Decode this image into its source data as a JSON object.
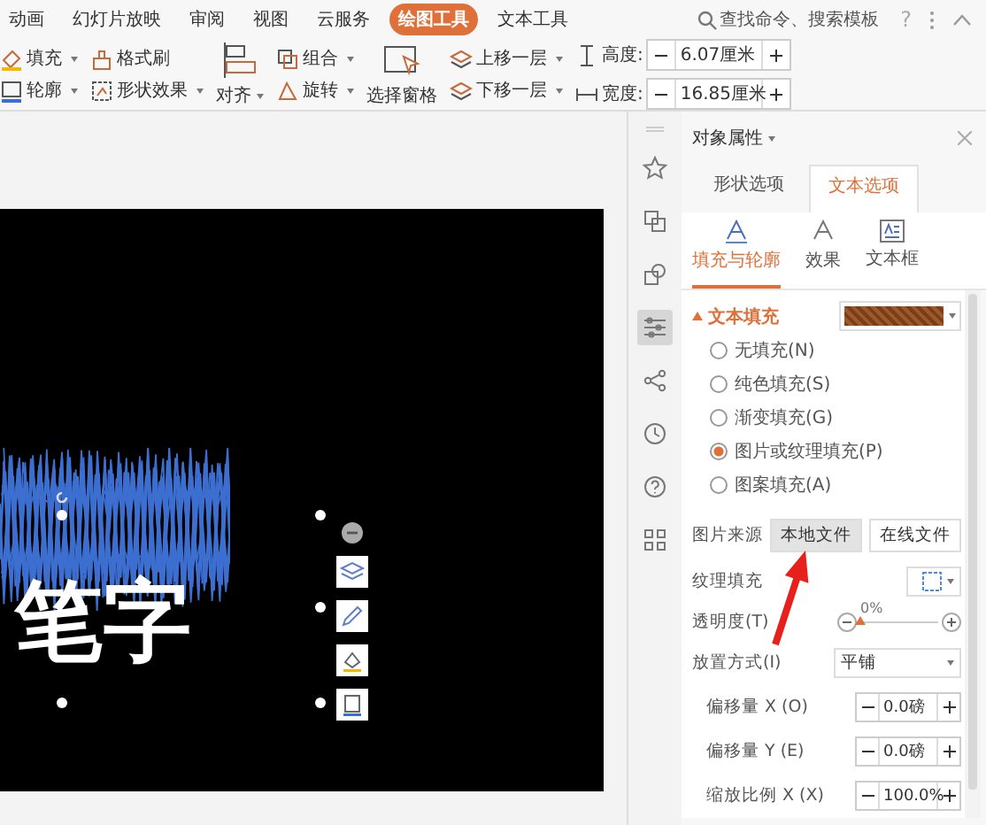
{
  "menu_tabs": [
    {
      "label": "动画",
      "selected": false
    },
    {
      "label": "幻灯片放映",
      "selected": false
    },
    {
      "label": "审阅",
      "selected": false
    },
    {
      "label": "视图",
      "selected": false
    },
    {
      "label": "云服务",
      "selected": false
    },
    {
      "label": "绘图工具",
      "selected": true
    },
    {
      "label": "文本工具",
      "selected": false
    }
  ],
  "search": {
    "placeholder": "查找命令、搜索模板"
  },
  "help": "?",
  "ribbon": [
    {
      "kind": "pair",
      "items": [
        {
          "label": "填充",
          "dropdown": true
        },
        {
          "label": "轮廓",
          "dropdown": true
        }
      ]
    },
    {
      "kind": "pair",
      "items": [
        {
          "label": "格式刷",
          "dropdown": false
        },
        {
          "label": "形状效果",
          "dropdown": true
        }
      ]
    },
    {
      "kind": "large",
      "label": "对齐",
      "dropdown": true
    },
    {
      "kind": "pair",
      "items": [
        {
          "label": "组合",
          "dropdown": true
        },
        {
          "label": "旋转",
          "dropdown": true
        }
      ]
    },
    {
      "kind": "large",
      "label": "选择窗格",
      "dropdown": false
    },
    {
      "kind": "pair",
      "items": [
        {
          "label": "上移一层",
          "dropdown": true
        },
        {
          "label": "下移一层",
          "dropdown": true
        }
      ]
    },
    {
      "kind": "size",
      "items": [
        {
          "label": "高度:",
          "value": "6.07厘米"
        },
        {
          "label": "宽度:",
          "value": "16.85厘米"
        }
      ]
    }
  ],
  "slide": {
    "text": "笔字"
  },
  "side_toolbar": [
    {
      "selected": false
    },
    {
      "selected": false
    },
    {
      "selected": false
    },
    {
      "selected": true
    },
    {
      "selected": false
    },
    {
      "selected": false
    },
    {
      "selected": false
    },
    {
      "selected": false
    }
  ],
  "panel": {
    "title": "对象属性",
    "tabs": [
      {
        "label": "形状选项",
        "selected": false
      },
      {
        "label": "文本选项",
        "selected": true
      }
    ],
    "subtabs": [
      {
        "label": "填充与轮廓",
        "selected": true
      },
      {
        "label": "效果",
        "selected": false
      },
      {
        "label": "文本框",
        "selected": false
      }
    ],
    "section": {
      "title": "文本填充",
      "expanded": true
    },
    "fill_options": [
      {
        "label": "无填充(N)",
        "selected": false
      },
      {
        "label": "纯色填充(S)",
        "selected": false
      },
      {
        "label": "渐变填充(G)",
        "selected": false
      },
      {
        "label": "图片或纹理填充(P)",
        "selected": true
      },
      {
        "label": "图案填充(A)",
        "selected": false
      }
    ],
    "picture_source": {
      "label": "图片来源",
      "buttons": [
        {
          "label": "本地文件",
          "pressed": true
        },
        {
          "label": "在线文件",
          "pressed": false
        }
      ]
    },
    "texture": {
      "label": "纹理填充"
    },
    "transparency": {
      "label": "透明度(T)",
      "reading": "0%",
      "level": 0
    },
    "placement": {
      "label": "放置方式(I)",
      "value": "平铺"
    },
    "steppers": [
      {
        "label": "偏移量 X (O)",
        "value": "0.0磅"
      },
      {
        "label": "偏移量 Y (E)",
        "value": "0.0磅"
      },
      {
        "label": "缩放比例 X (X)",
        "value": "100.0%"
      }
    ]
  }
}
